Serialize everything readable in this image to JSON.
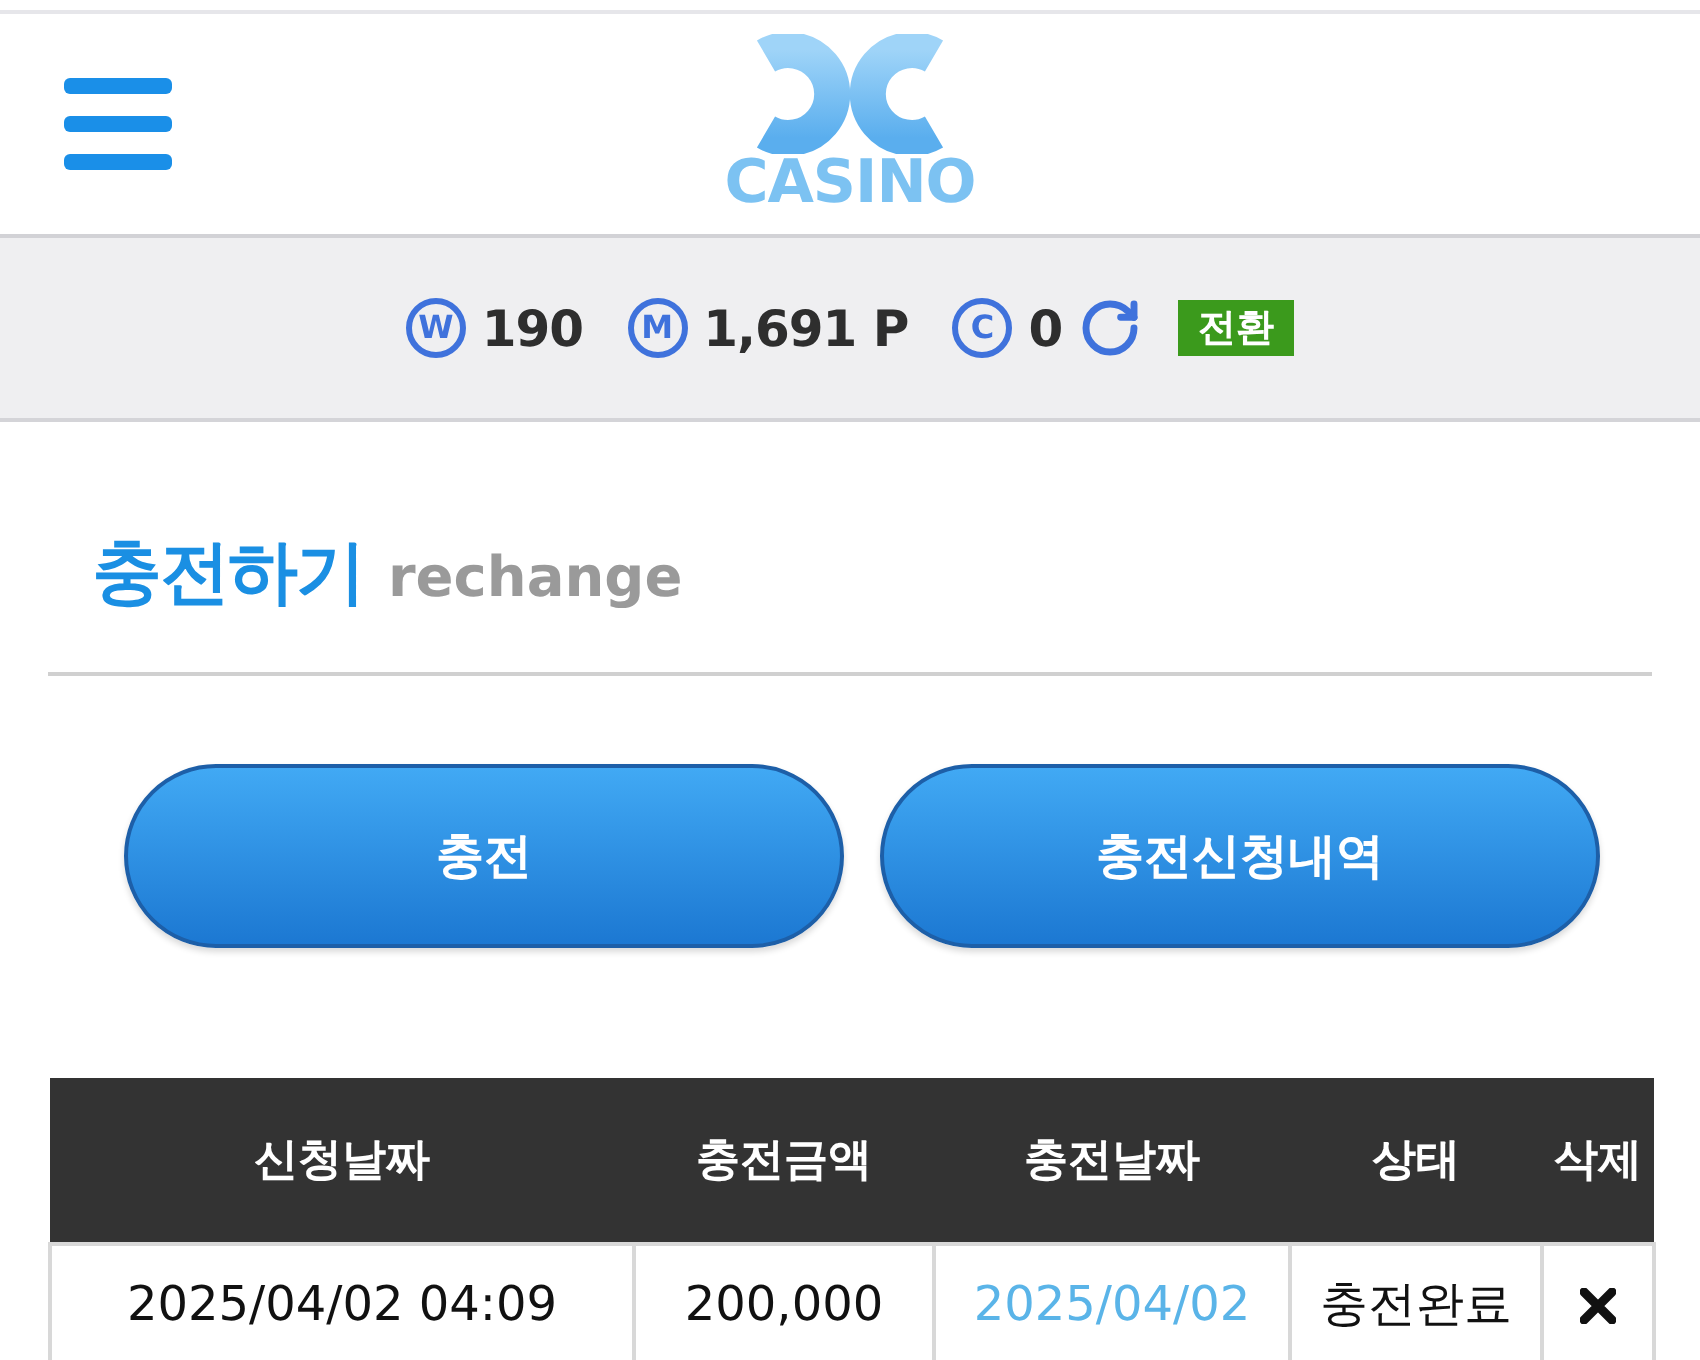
{
  "header": {
    "logo_text": "CASINO"
  },
  "balance_bar": {
    "items": [
      {
        "symbol": "W",
        "value": "190"
      },
      {
        "symbol": "M",
        "value": "1,691 P"
      },
      {
        "symbol": "C",
        "value": "0"
      }
    ],
    "convert_button": "전환"
  },
  "section": {
    "title": "충전하기",
    "subtitle": "rechange"
  },
  "buttons": [
    {
      "label": "충전"
    },
    {
      "label": "충전신청내역"
    }
  ],
  "table": {
    "columns": [
      "신청날짜",
      "충전금액",
      "충전날짜",
      "상태",
      "삭제"
    ],
    "rows": [
      {
        "request_date": "2025/04/02 04:09",
        "amount": "200,000",
        "charge_date": "2025/04/02",
        "status": "충전완료"
      }
    ]
  }
}
